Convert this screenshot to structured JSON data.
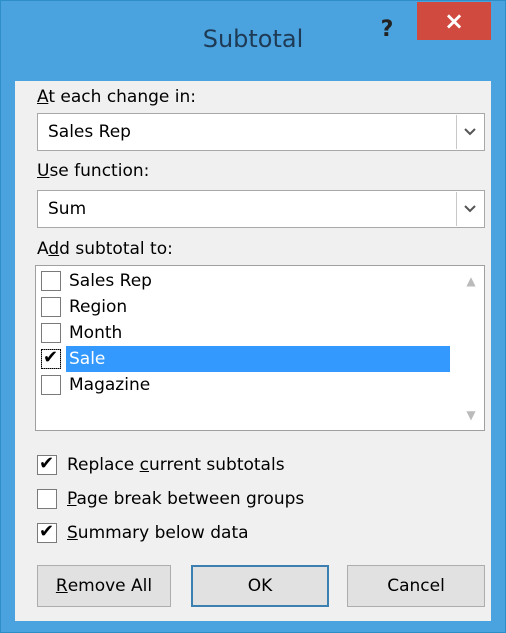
{
  "dialog": {
    "title": "Subtotal",
    "help_glyph": "?",
    "close_glyph": "×"
  },
  "at_each_change": {
    "label_prefix": "",
    "label_accel": "A",
    "label_rest": "t each change in:",
    "value": "Sales Rep"
  },
  "use_function": {
    "label_prefix": "",
    "label_accel": "U",
    "label_rest": "se function:",
    "value": "Sum"
  },
  "add_subtotal": {
    "label_prefix": "A",
    "label_accel": "d",
    "label_rest": "d subtotal to:",
    "items": [
      {
        "label": "Sales Rep",
        "checked": false,
        "selected": false
      },
      {
        "label": "Region",
        "checked": false,
        "selected": false
      },
      {
        "label": "Month",
        "checked": false,
        "selected": false
      },
      {
        "label": "Sale",
        "checked": true,
        "selected": true
      },
      {
        "label": "Magazine",
        "checked": false,
        "selected": false
      }
    ]
  },
  "options": {
    "replace": {
      "prefix": "Replace ",
      "accel": "c",
      "rest": "urrent subtotals",
      "checked": true
    },
    "page_break": {
      "prefix": "",
      "accel": "P",
      "rest": "age break between groups",
      "checked": false
    },
    "summary": {
      "prefix": "",
      "accel": "S",
      "rest": "ummary below data",
      "checked": true
    }
  },
  "buttons": {
    "remove_all": {
      "accel": "R",
      "rest": "emove All"
    },
    "ok": "OK",
    "cancel": "Cancel"
  },
  "icons": {
    "dropdown": "chevron-down-icon",
    "check": "✔",
    "scroll_up": "▲",
    "scroll_down": "▼"
  },
  "colors": {
    "titlebar": "#4aa3de",
    "close": "#d04a3f",
    "selection": "#3399ff"
  }
}
